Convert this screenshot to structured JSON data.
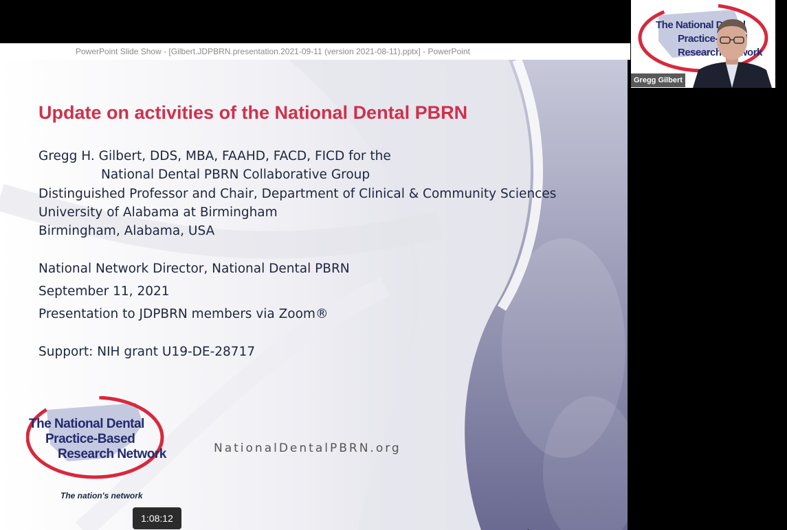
{
  "window": {
    "title": "PowerPoint Slide Show - [Gilbert.JDPBRN.presentation.2021-09-11 (version 2021-08-11).pptx] - PowerPoint"
  },
  "slide": {
    "title": "Update on activities of the National Dental PBRN",
    "lines": [
      "Gregg H. Gilbert, DDS, MBA, FAAHD, FACD, FICD for the",
      "National Dental PBRN Collaborative Group",
      "Distinguished Professor and Chair, Department of Clinical & Community Sciences",
      "University of Alabama at Birmingham",
      "Birmingham, Alabama, USA",
      "National Network Director, National Dental PBRN",
      "September 11, 2021",
      "Presentation to JDPBRN members via Zoom®",
      "Support: NIH grant U19-DE-28717"
    ],
    "url": "NationalDentalPBRN.org",
    "logo": {
      "line1": "The National Dental",
      "line2": "Practice-Based",
      "line3": "Research Network",
      "tagline": "The nation's network"
    }
  },
  "recording_time": "1:08:12",
  "video": {
    "participant_name": "Gregg Gilbert",
    "logo_line1": "The National Dental",
    "logo_line2": "Practice-Based",
    "logo_line3": "Research Network"
  },
  "colors": {
    "title": "#d0304b",
    "text": "#1d2540",
    "logo_blue": "#232a6e",
    "logo_red": "#d8283c"
  }
}
